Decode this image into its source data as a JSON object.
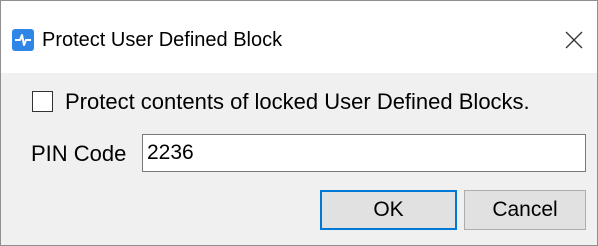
{
  "window": {
    "title": "Protect User Defined Block",
    "app_icon": "app-logo-icon",
    "close_icon": "close-icon"
  },
  "protect_option": {
    "label": "Protect contents of locked User Defined Blocks.",
    "checked": false
  },
  "pin": {
    "label": "PIN Code",
    "value": "2236"
  },
  "buttons": {
    "ok_label": "OK",
    "cancel_label": "Cancel"
  },
  "colors": {
    "accent": "#0078d7",
    "app_icon": "#2f86e6",
    "dialog_bg": "#f0f0f0"
  }
}
